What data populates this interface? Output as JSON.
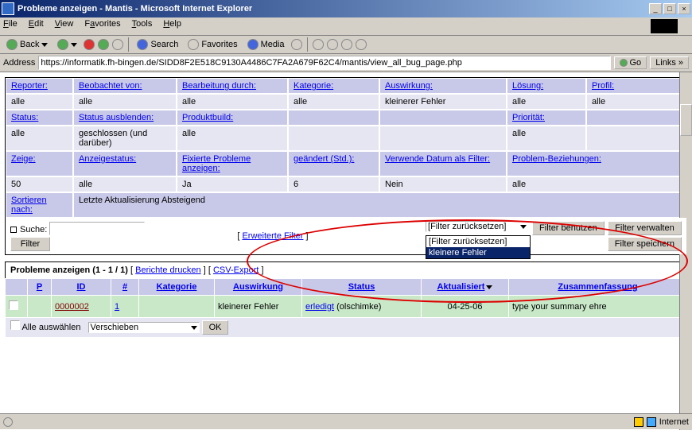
{
  "window": {
    "title": "Probleme anzeigen - Mantis - Microsoft Internet Explorer"
  },
  "menu": {
    "file": "File",
    "edit": "Edit",
    "view": "View",
    "favorites": "Favorites",
    "tools": "Tools",
    "help": "Help"
  },
  "toolbar": {
    "back": "Back",
    "search": "Search",
    "favorites": "Favorites",
    "media": "Media"
  },
  "address": {
    "label": "Address",
    "url": "https://informatik.fh-bingen.de/SIDD8F2E518C9130A4486C7FA2A679F62C4/mantis/view_all_bug_page.php",
    "go": "Go",
    "links": "Links"
  },
  "filters": {
    "r1h": [
      "Reporter:",
      "Beobachtet von:",
      "Bearbeitung durch:",
      "Kategorie:",
      "Auswirkung:",
      "Lösung:",
      "Profil:"
    ],
    "r1v": [
      "alle",
      "alle",
      "alle",
      "alle",
      "kleinerer Fehler",
      "alle",
      "alle"
    ],
    "r2h": [
      "Status:",
      "Status ausblenden:",
      "Produktbuild:",
      "",
      "",
      "Priorität:",
      ""
    ],
    "r2v": [
      "alle",
      "geschlossen (und darüber)",
      "alle",
      "",
      "",
      "alle",
      ""
    ],
    "r3h": [
      "Zeige:",
      "Anzeigestatus:",
      "Fixierte Probleme anzeigen:",
      "geändert (Std.):",
      "Verwende Datum als Filter:",
      "Problem-Beziehungen:",
      ""
    ],
    "r3v": [
      "50",
      "alle",
      "Ja",
      "6",
      "Nein",
      "alle",
      ""
    ],
    "r4h": [
      "Sortieren nach:",
      "Letzte Aktualisierung Absteigend"
    ]
  },
  "search": {
    "label": "Suche:",
    "erw": "Erweiterte Filter",
    "sel": "[Filter zurücksetzen]",
    "opt1": "[Filter zurücksetzen]",
    "opt2": "kleinere Fehler",
    "benutzen": "Filter benutzen",
    "verwalten": "Filter verwalten",
    "speichern": "Filter speichern",
    "filterbtn": "Filter"
  },
  "list": {
    "title": "Probleme anzeigen (1 - 1 / 1)",
    "berichte": "Berichte drucken",
    "csv": "CSV-Export",
    "cols": {
      "p": "P",
      "id": "ID",
      "num": "#",
      "kat": "Kategorie",
      "ausw": "Auswirkung",
      "status": "Status",
      "akt": "Aktualisiert",
      "zusammen": "Zusammenfassung"
    },
    "row": {
      "id": "0000002",
      "num": "1",
      "ausw": "kleinerer Fehler",
      "status": "erledigt",
      "statuswho": "(olschimke)",
      "akt": "04-25-06",
      "zusammen": "type your summary ehre"
    },
    "selall": "Alle auswählen",
    "action": "Verschieben",
    "ok": "OK"
  },
  "status": {
    "zone": "Internet"
  }
}
